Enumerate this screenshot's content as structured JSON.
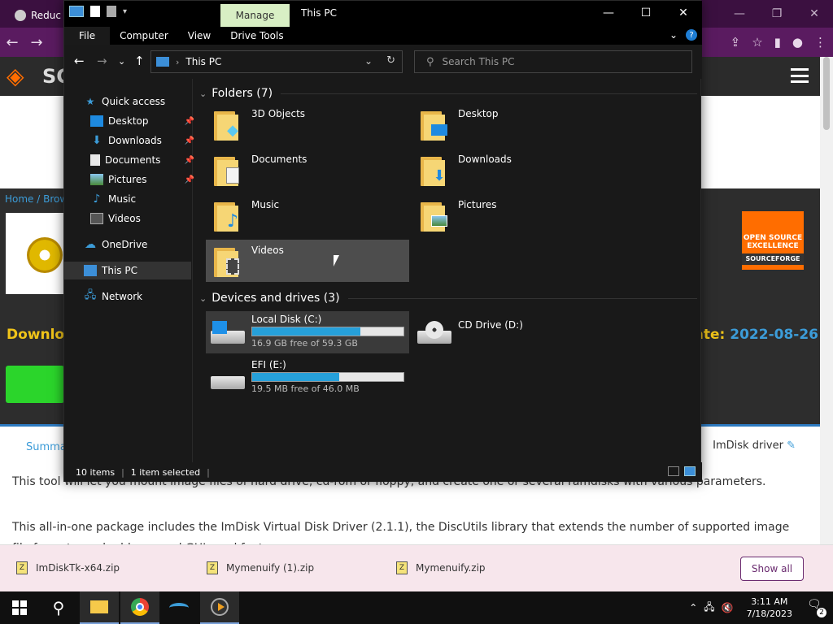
{
  "browser": {
    "tab_title": "Reduc",
    "page": {
      "logo_text": "SC",
      "breadcrumb": "Home / Brow",
      "download_title": "Downloa",
      "updated_label": "odate:",
      "updated_value": "2022-08-26",
      "badge_line1": "OPEN SOURCE",
      "badge_line2": "EXCELLENCE",
      "badge_line3": "SOURCEFORGE",
      "tab_summary": "Summa",
      "tab_imdisk": "ImDisk driver",
      "desc1": "This tool will let you mount image files of hard drive, cd-rom or floppy, and create one or several ramdisks with various parameters.",
      "desc2": "This all-in-one package includes the ImDisk Virtual Disk Driver (2.1.1), the DiscUtils library that extends the number of supported image file formats, and adds several GUIs and features."
    },
    "downloads": [
      {
        "name": "ImDiskTk-x64.zip"
      },
      {
        "name": "Mymenuify (1).zip"
      },
      {
        "name": "Mymenuify.zip"
      }
    ],
    "show_all_label": "Show all"
  },
  "explorer": {
    "title": "This PC",
    "manage_label": "Manage",
    "ribbon_tabs": [
      "File",
      "Computer",
      "View",
      "Drive Tools"
    ],
    "address": "This PC",
    "search_placeholder": "Search This PC",
    "nav": [
      {
        "label": "Quick access",
        "icon": "star-icon"
      },
      {
        "label": "Desktop",
        "icon": "desktop-icon",
        "pinned": true
      },
      {
        "label": "Downloads",
        "icon": "download-icon",
        "pinned": true
      },
      {
        "label": "Documents",
        "icon": "document-icon",
        "pinned": true
      },
      {
        "label": "Pictures",
        "icon": "picture-icon",
        "pinned": true
      },
      {
        "label": "Music",
        "icon": "music-icon"
      },
      {
        "label": "Videos",
        "icon": "video-icon"
      },
      {
        "label": "OneDrive",
        "icon": "cloud-icon"
      },
      {
        "label": "This PC",
        "icon": "computer-icon",
        "selected": true
      },
      {
        "label": "Network",
        "icon": "network-icon"
      }
    ],
    "folders_header": "Folders (7)",
    "folders": [
      {
        "label": "3D Objects",
        "icon": "cube-icon"
      },
      {
        "label": "Desktop",
        "icon": "desktop-icon"
      },
      {
        "label": "Documents",
        "icon": "document-icon"
      },
      {
        "label": "Downloads",
        "icon": "download-icon"
      },
      {
        "label": "Music",
        "icon": "music-icon"
      },
      {
        "label": "Pictures",
        "icon": "picture-icon"
      },
      {
        "label": "Videos",
        "icon": "video-icon"
      }
    ],
    "devices_header": "Devices and drives (3)",
    "drives": [
      {
        "label": "Local Disk (C:)",
        "free": "16.9 GB free of 59.3 GB",
        "used_fraction": 0.715
      },
      {
        "label": "CD Drive (D:)"
      },
      {
        "label": "EFI (E:)",
        "free": "19.5 MB free of 46.0 MB",
        "used_fraction": 0.576
      }
    ],
    "status_items": "10 items",
    "status_selected": "1 item selected"
  },
  "taskbar": {
    "time": "3:11 AM",
    "date": "7/18/2023",
    "notifications": "2"
  }
}
